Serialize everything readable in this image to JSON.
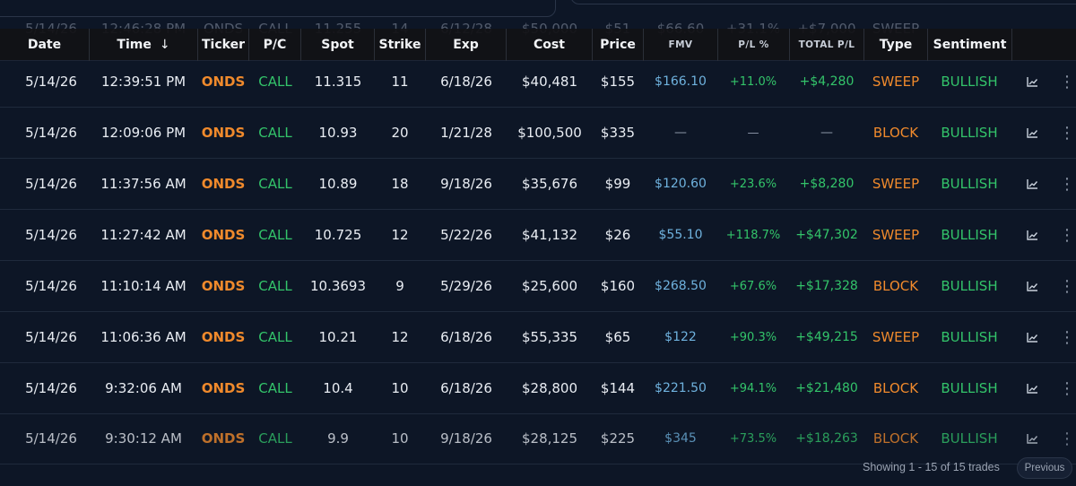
{
  "top_ghost_row": {
    "date": "5/14/26",
    "time": "12:46:28 PM",
    "ticker": "ONDS",
    "pc": "CALL",
    "spot": "11.255",
    "strike": "14",
    "exp": "6/12/28",
    "cost": "$50,000",
    "price": "$51",
    "fmv": "$66.60",
    "pl": "+31.1%",
    "total": "+$7,000",
    "type": "SWEEP"
  },
  "columns": {
    "date": "Date",
    "time": "Time",
    "time_sort_icon": "↓",
    "ticker": "Ticker",
    "pc": "P/C",
    "spot": "Spot",
    "strike": "Strike",
    "exp": "Exp",
    "cost": "Cost",
    "price": "Price",
    "fmv": "FMV",
    "pl": "P/L %",
    "total": "TOTAL P/L",
    "type": "Type",
    "sentiment": "Sentiment"
  },
  "rows": [
    {
      "date": "5/14/26",
      "time": "12:39:51 PM",
      "ticker": "ONDS",
      "pc": "CALL",
      "spot": "11.315",
      "strike": "11",
      "exp": "6/18/26",
      "cost": "$40,481",
      "price": "$155",
      "fmv": "$166.10",
      "pl": "+11.0%",
      "total": "+$4,280",
      "type": "SWEEP",
      "sentiment": "BULLISH"
    },
    {
      "date": "5/14/26",
      "time": "12:09:06 PM",
      "ticker": "ONDS",
      "pc": "CALL",
      "spot": "10.93",
      "strike": "20",
      "exp": "1/21/28",
      "cost": "$100,500",
      "price": "$335",
      "fmv": "—",
      "pl": "—",
      "total": "—",
      "type": "BLOCK",
      "sentiment": "BULLISH"
    },
    {
      "date": "5/14/26",
      "time": "11:37:56 AM",
      "ticker": "ONDS",
      "pc": "CALL",
      "spot": "10.89",
      "strike": "18",
      "exp": "9/18/26",
      "cost": "$35,676",
      "price": "$99",
      "fmv": "$120.60",
      "pl": "+23.6%",
      "total": "+$8,280",
      "type": "SWEEP",
      "sentiment": "BULLISH"
    },
    {
      "date": "5/14/26",
      "time": "11:27:42 AM",
      "ticker": "ONDS",
      "pc": "CALL",
      "spot": "10.725",
      "strike": "12",
      "exp": "5/22/26",
      "cost": "$41,132",
      "price": "$26",
      "fmv": "$55.10",
      "pl": "+118.7%",
      "total": "+$47,302",
      "type": "SWEEP",
      "sentiment": "BULLISH"
    },
    {
      "date": "5/14/26",
      "time": "11:10:14 AM",
      "ticker": "ONDS",
      "pc": "CALL",
      "spot": "10.3693",
      "strike": "9",
      "exp": "5/29/26",
      "cost": "$25,600",
      "price": "$160",
      "fmv": "$268.50",
      "pl": "+67.6%",
      "total": "+$17,328",
      "type": "BLOCK",
      "sentiment": "BULLISH"
    },
    {
      "date": "5/14/26",
      "time": "11:06:36 AM",
      "ticker": "ONDS",
      "pc": "CALL",
      "spot": "10.21",
      "strike": "12",
      "exp": "6/18/26",
      "cost": "$55,335",
      "price": "$65",
      "fmv": "$122",
      "pl": "+90.3%",
      "total": "+$49,215",
      "type": "SWEEP",
      "sentiment": "BULLISH"
    },
    {
      "date": "5/14/26",
      "time": "9:32:06 AM",
      "ticker": "ONDS",
      "pc": "CALL",
      "spot": "10.4",
      "strike": "10",
      "exp": "6/18/26",
      "cost": "$28,800",
      "price": "$144",
      "fmv": "$221.50",
      "pl": "+94.1%",
      "total": "+$21,480",
      "type": "BLOCK",
      "sentiment": "BULLISH"
    },
    {
      "date": "5/14/26",
      "time": "9:30:12 AM",
      "ticker": "ONDS",
      "pc": "CALL",
      "spot": "9.9",
      "strike": "10",
      "exp": "9/18/26",
      "cost": "$28,125",
      "price": "$225",
      "fmv": "$345",
      "pl": "+73.5%",
      "total": "+$18,263",
      "type": "BLOCK",
      "sentiment": "BULLISH"
    }
  ],
  "icons": {
    "row_chart": "line-chart-icon",
    "row_menu": "more-vertical-icon"
  },
  "footer": {
    "showing": "Showing 1 - 15 of 15 trades",
    "previous": "Previous"
  },
  "colors": {
    "background": "#0d1626",
    "ticker": "#f08a2c",
    "positive": "#33c46a",
    "fmv": "#6fb2de",
    "header_bg": "#121216"
  }
}
